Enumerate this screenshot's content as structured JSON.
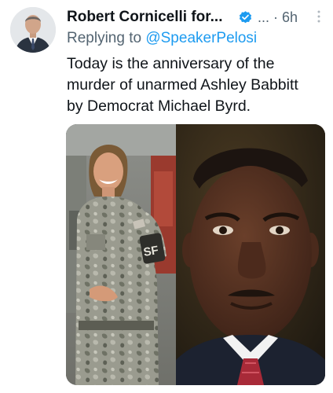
{
  "tweet": {
    "author_name": "Robert Cornicelli for...",
    "time_label": "... · 6h",
    "reply_prefix": "Replying to",
    "reply_handle": "@SpeakerPelosi",
    "text_lines": [
      "Today is the anniversary of the",
      "murder of unarmed Ashley Babbitt",
      "by Democrat Michael Byrd."
    ]
  },
  "media": {
    "left_photo": {
      "patch_text": "SF"
    },
    "right_photo": {}
  },
  "icons": {
    "verified": "verified-badge-icon",
    "more": "more-options-icon"
  },
  "colors": {
    "text": "#0f1419",
    "secondary": "#536471",
    "link": "#1d9bf0"
  }
}
